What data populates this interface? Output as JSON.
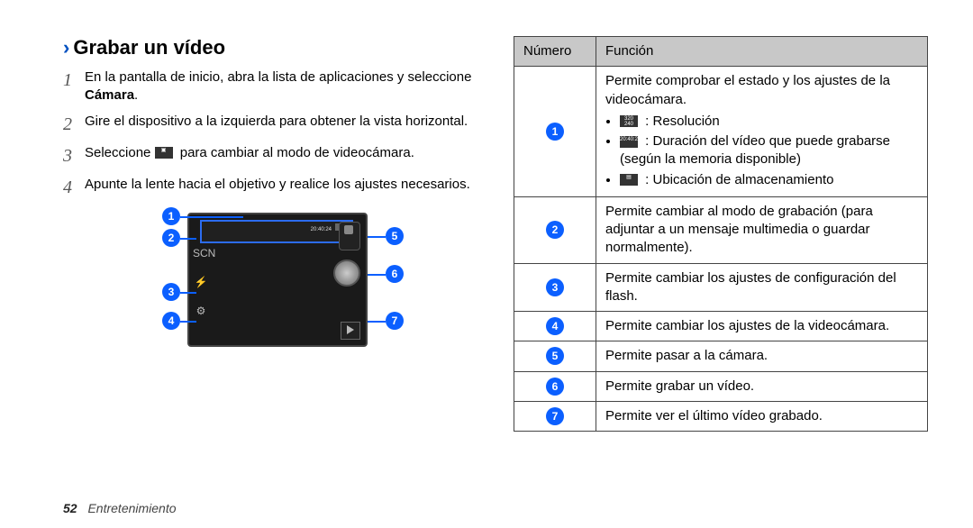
{
  "heading": "Grabar un vídeo",
  "steps": [
    {
      "n": "1",
      "pre": "En la pantalla de inicio, abra la lista de aplicaciones y seleccione ",
      "bold": "Cámara",
      "post": "."
    },
    {
      "n": "2",
      "text": "Gire el dispositivo a la izquierda para obtener la vista horizontal."
    },
    {
      "n": "3",
      "pre": "Seleccione ",
      "icon": true,
      "post": " para cambiar al modo de videocámara."
    },
    {
      "n": "4",
      "text": "Apunte la lente hacia el objetivo y realice los ajustes necesarios."
    }
  ],
  "figure": {
    "timecode": "20:40:24"
  },
  "table": {
    "head": {
      "c1": "Número",
      "c2": "Función"
    },
    "rows": [
      {
        "n": "1",
        "plain": "Permite comprobar el estado y los ajustes de la videocámara.",
        "bullets": [
          {
            "icon": "res",
            "label": " : Resolución"
          },
          {
            "icon": "time",
            "label": " : Duración del vídeo que puede grabarse (según la memoria disponible)"
          },
          {
            "icon": "store",
            "label": " : Ubicación de almacenamiento"
          }
        ]
      },
      {
        "n": "2",
        "plain": "Permite cambiar al modo de grabación (para adjuntar a un mensaje multimedia o guardar normalmente)."
      },
      {
        "n": "3",
        "plain": "Permite cambiar los ajustes de configuración del flash."
      },
      {
        "n": "4",
        "plain": "Permite cambiar los ajustes de la videocámara."
      },
      {
        "n": "5",
        "plain": "Permite pasar a la cámara."
      },
      {
        "n": "6",
        "plain": "Permite grabar un vídeo."
      },
      {
        "n": "7",
        "plain": "Permite ver el último vídeo grabado."
      }
    ]
  },
  "footer": {
    "page": "52",
    "section": "Entretenimiento"
  }
}
